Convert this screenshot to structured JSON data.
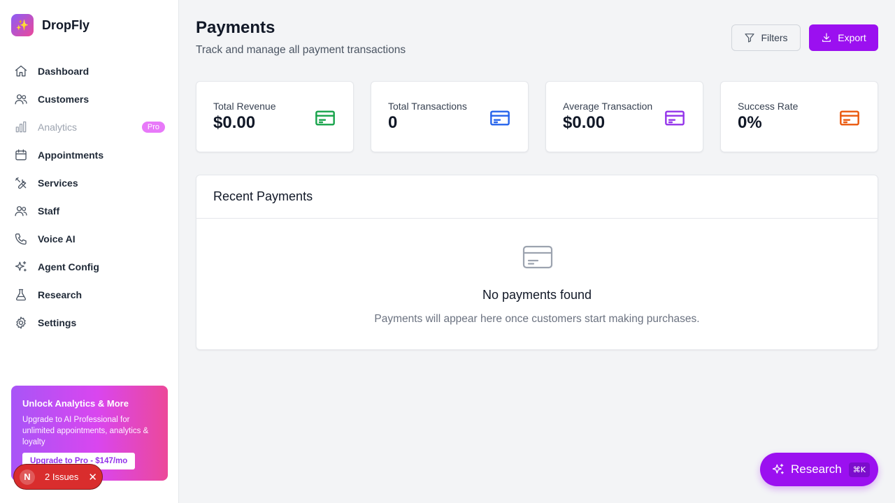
{
  "app": {
    "name": "DropFly",
    "logo_glyph": "✨"
  },
  "sidebar": {
    "items": [
      {
        "label": "Dashboard",
        "icon": "home-icon"
      },
      {
        "label": "Customers",
        "icon": "users-icon"
      },
      {
        "label": "Analytics",
        "icon": "bar-chart-icon",
        "badge": "Pro",
        "disabled": true
      },
      {
        "label": "Appointments",
        "icon": "calendar-icon"
      },
      {
        "label": "Services",
        "icon": "tools-icon"
      },
      {
        "label": "Staff",
        "icon": "users-icon"
      },
      {
        "label": "Voice AI",
        "icon": "phone-icon"
      },
      {
        "label": "Agent Config",
        "icon": "sparkles-icon"
      },
      {
        "label": "Research",
        "icon": "flask-icon"
      },
      {
        "label": "Settings",
        "icon": "gear-icon"
      }
    ],
    "upsell": {
      "title": "Unlock Analytics & More",
      "text": "Upgrade to AI Professional for unlimited appointments, analytics & loyalty",
      "button": "Upgrade to Pro - $147/mo"
    }
  },
  "issues_badge": {
    "letter": "N",
    "text": "2 Issues",
    "close": "✕"
  },
  "header": {
    "title": "Payments",
    "subtitle": "Track and manage all payment transactions",
    "filters_label": "Filters",
    "export_label": "Export"
  },
  "stats": [
    {
      "label": "Total Revenue",
      "value": "$0.00",
      "icon": "credit-card-icon",
      "color": "#16a34a"
    },
    {
      "label": "Total Transactions",
      "value": "0",
      "icon": "credit-card-icon",
      "color": "#2563eb"
    },
    {
      "label": "Average Transaction",
      "value": "$0.00",
      "icon": "credit-card-icon",
      "color": "#9333ea"
    },
    {
      "label": "Success Rate",
      "value": "0%",
      "icon": "credit-card-icon",
      "color": "#ea580c"
    }
  ],
  "recent_payments": {
    "title": "Recent Payments",
    "empty_title": "No payments found",
    "empty_text": "Payments will appear here once customers start making purchases."
  },
  "fab": {
    "label": "Research",
    "shortcut": "⌘K"
  },
  "colors": {
    "accent": "#9b10f0",
    "danger": "#d92d2d"
  }
}
